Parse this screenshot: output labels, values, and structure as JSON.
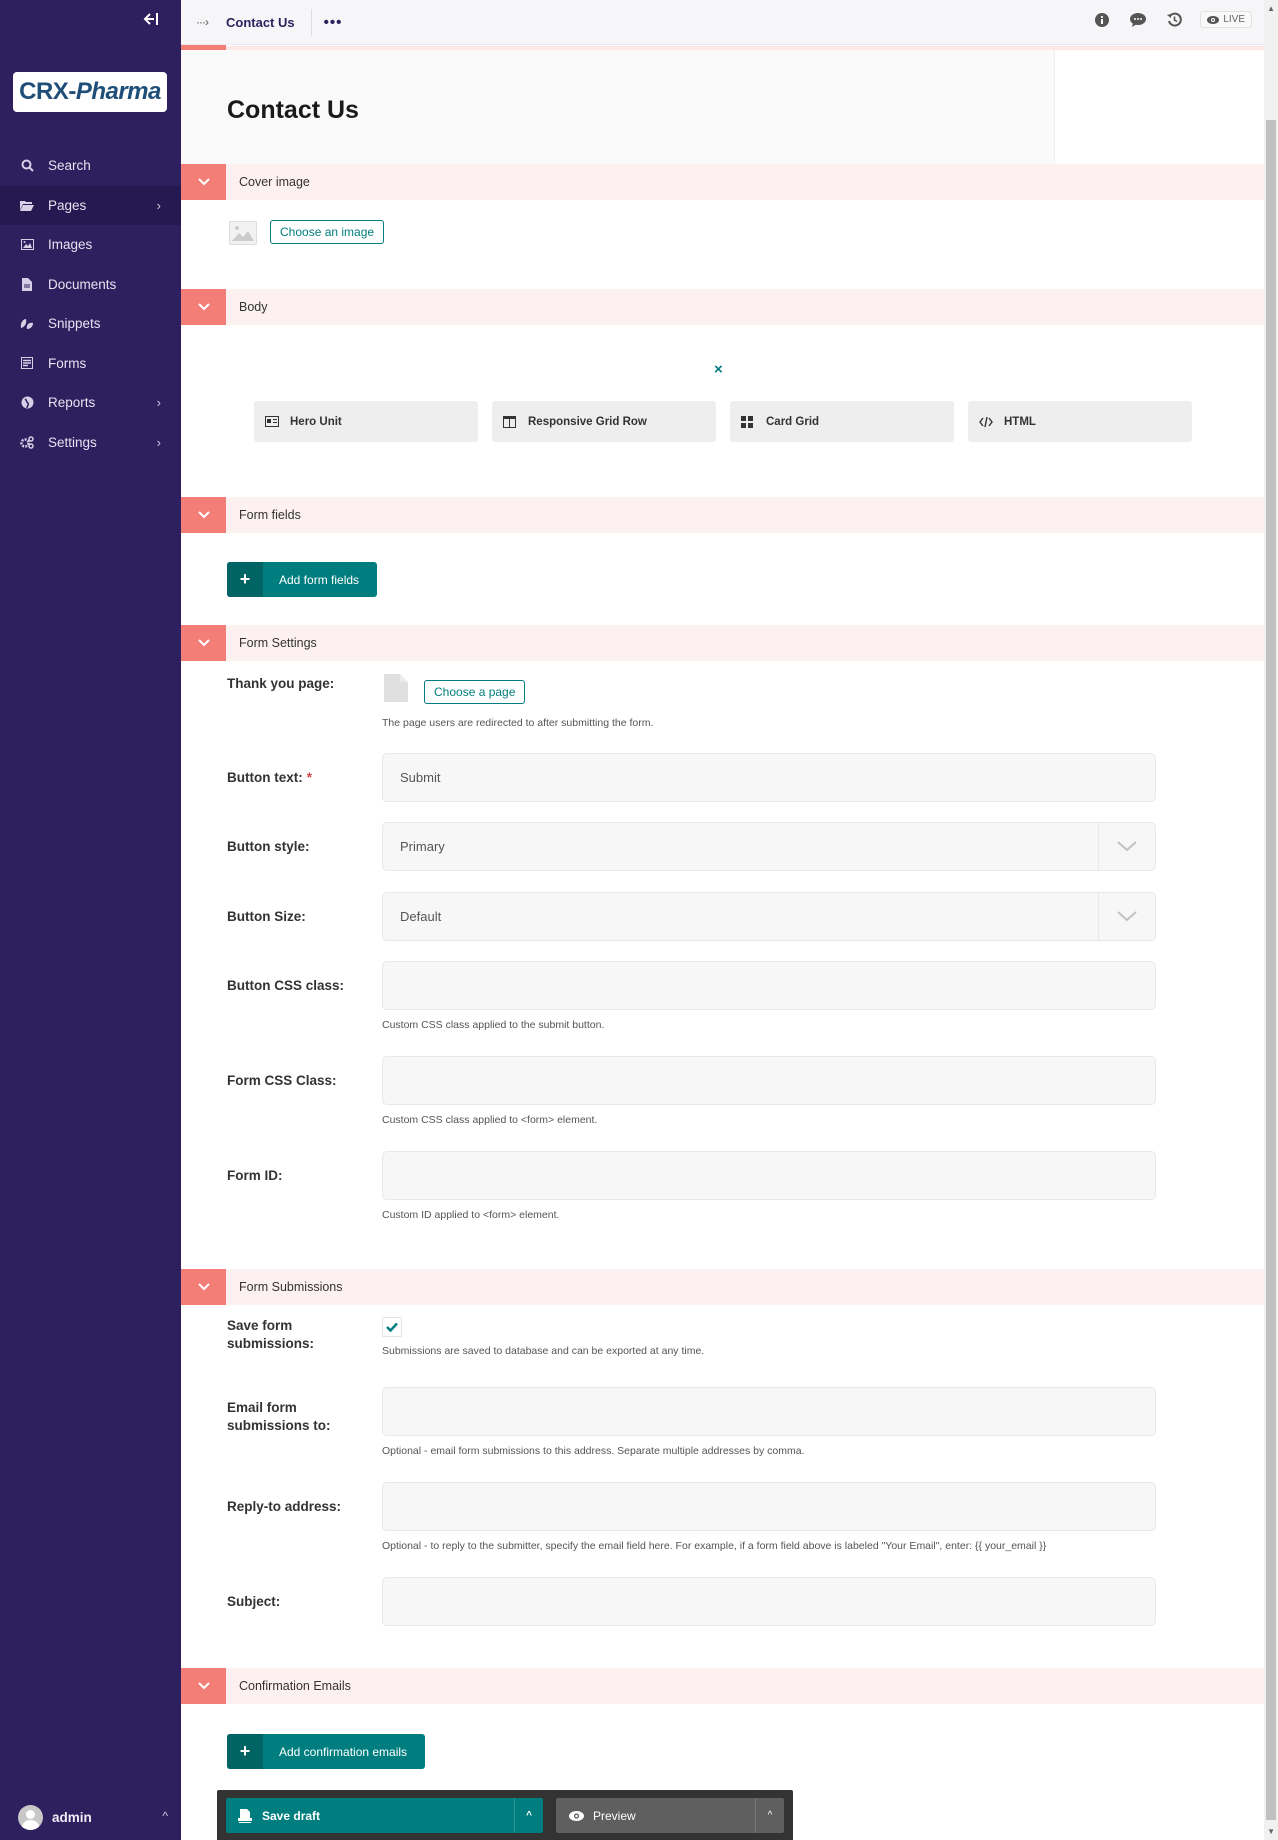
{
  "sidebar": {
    "logo_text_a": "CRX-",
    "logo_text_b": "Pharma",
    "items": [
      {
        "label": "Search",
        "icon": "search-icon"
      },
      {
        "label": "Pages",
        "icon": "folder-open-icon",
        "has_submenu": true,
        "active": true
      },
      {
        "label": "Images",
        "icon": "image-icon"
      },
      {
        "label": "Documents",
        "icon": "document-icon"
      },
      {
        "label": "Snippets",
        "icon": "snippets-icon"
      },
      {
        "label": "Forms",
        "icon": "form-icon"
      },
      {
        "label": "Reports",
        "icon": "globe-icon",
        "has_submenu": true
      },
      {
        "label": "Settings",
        "icon": "cogs-icon",
        "has_submenu": true
      }
    ],
    "user": {
      "name": "admin"
    }
  },
  "topbar": {
    "breadcrumb_title": "Contact Us",
    "more_label": "•••",
    "live_label": "LIVE"
  },
  "page": {
    "title": "Contact Us"
  },
  "sections": {
    "cover_image": {
      "title": "Cover image",
      "choose_label": "Choose an image"
    },
    "body": {
      "title": "Body",
      "close_label": "×",
      "blocks": [
        {
          "label": "Hero Unit",
          "icon": "hero-unit-icon"
        },
        {
          "label": "Responsive Grid Row",
          "icon": "columns-icon"
        },
        {
          "label": "Card Grid",
          "icon": "grid-icon"
        },
        {
          "label": "HTML",
          "icon": "code-icon"
        }
      ]
    },
    "form_fields": {
      "title": "Form fields",
      "add_label": "Add form fields"
    },
    "form_settings": {
      "title": "Form Settings",
      "thank_you": {
        "label": "Thank you page:",
        "choose_label": "Choose a page",
        "help": "The page users are redirected to after submitting the form."
      },
      "button_text": {
        "label": "Button text:",
        "required": "*",
        "value": "Submit"
      },
      "button_style": {
        "label": "Button style:",
        "value": "Primary"
      },
      "button_size": {
        "label": "Button Size:",
        "value": "Default"
      },
      "button_css": {
        "label": "Button CSS class:",
        "value": "",
        "help": "Custom CSS class applied to the submit button."
      },
      "form_css": {
        "label": "Form CSS Class:",
        "value": "",
        "help": "Custom CSS class applied to <form> element."
      },
      "form_id": {
        "label": "Form ID:",
        "value": "",
        "help": "Custom ID applied to <form> element."
      }
    },
    "form_submissions": {
      "title": "Form Submissions",
      "save": {
        "label_1": "Save form",
        "label_2": "submissions:",
        "checked": true,
        "help": "Submissions are saved to database and can be exported at any time."
      },
      "email_to": {
        "label_1": "Email form",
        "label_2": "submissions to:",
        "value": "",
        "help": "Optional - email form submissions to this address. Separate multiple addresses by comma."
      },
      "reply_to": {
        "label": "Reply-to address:",
        "value": "",
        "help": "Optional - to reply to the submitter, specify the email field here. For example, if a form field above is labeled \"Your Email\", enter: {{ your_email }}"
      },
      "subject": {
        "label": "Subject:",
        "value": ""
      }
    },
    "confirmation_emails": {
      "title": "Confirmation Emails",
      "add_label": "Add confirmation emails"
    }
  },
  "footer": {
    "save_draft_label": "Save draft",
    "preview_label": "Preview"
  },
  "colors": {
    "sidebar": "#2e1f5e",
    "accent": "#f37e77",
    "primary": "#007d7e",
    "section_bg": "#fdf0f0"
  }
}
